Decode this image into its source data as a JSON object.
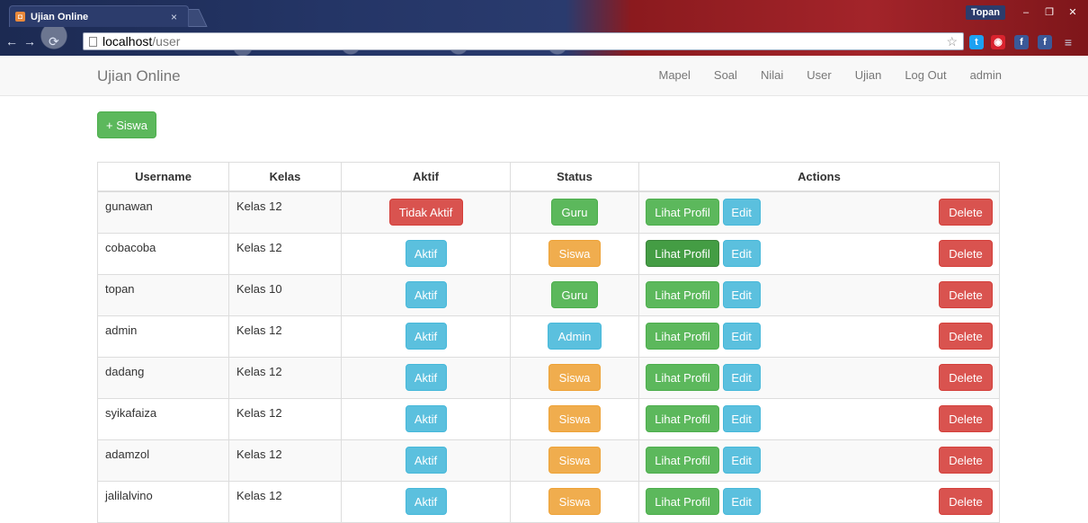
{
  "browser": {
    "tab_title": "Ujian Online",
    "tab_close": "×",
    "user_label": "Topan",
    "window_controls": [
      "–",
      "❐",
      "✕"
    ],
    "address_host": "localhost",
    "address_path": "/user",
    "extensions": [
      {
        "name": "twitter-extension-icon",
        "glyph": "t",
        "color": "#1da1f2"
      },
      {
        "name": "record-extension-icon",
        "glyph": "◉",
        "color": "#d9232e"
      },
      {
        "name": "facebook-extension-icon",
        "glyph": "f",
        "color": "#3b5998"
      },
      {
        "name": "facebook-alt-extension-icon",
        "glyph": "f",
        "color": "#3b5998"
      }
    ]
  },
  "navbar": {
    "brand": "Ujian Online",
    "menu": [
      "Mapel",
      "Soal",
      "Nilai",
      "User",
      "Ujian",
      "Log Out",
      "admin"
    ]
  },
  "add_button": "+ Siswa",
  "table": {
    "headers": [
      "Username",
      "Kelas",
      "Aktif",
      "Status",
      "Actions"
    ],
    "action_labels": {
      "profile": "Lihat Profil",
      "edit": "Edit",
      "delete": "Delete"
    },
    "rows": [
      {
        "username": "gunawan",
        "kelas": "Kelas 12",
        "aktif": "Tidak Aktif",
        "status": "Guru"
      },
      {
        "username": "cobacoba",
        "kelas": "Kelas 12",
        "aktif": "Aktif",
        "status": "Siswa"
      },
      {
        "username": "topan",
        "kelas": "Kelas 10",
        "aktif": "Aktif",
        "status": "Guru"
      },
      {
        "username": "admin",
        "kelas": "Kelas 12",
        "aktif": "Aktif",
        "status": "Admin"
      },
      {
        "username": "dadang",
        "kelas": "Kelas 12",
        "aktif": "Aktif",
        "status": "Siswa"
      },
      {
        "username": "syikafaiza",
        "kelas": "Kelas 12",
        "aktif": "Aktif",
        "status": "Siswa"
      },
      {
        "username": "adamzol",
        "kelas": "Kelas 12",
        "aktif": "Aktif",
        "status": "Siswa"
      },
      {
        "username": "jalilalvino",
        "kelas": "Kelas 12",
        "aktif": "Aktif",
        "status": "Siswa"
      }
    ]
  },
  "colors": {
    "success": "#5cb85c",
    "success_active": "#449d44",
    "danger": "#d9534f",
    "info": "#5bc0de",
    "warning": "#f0ad4e"
  }
}
